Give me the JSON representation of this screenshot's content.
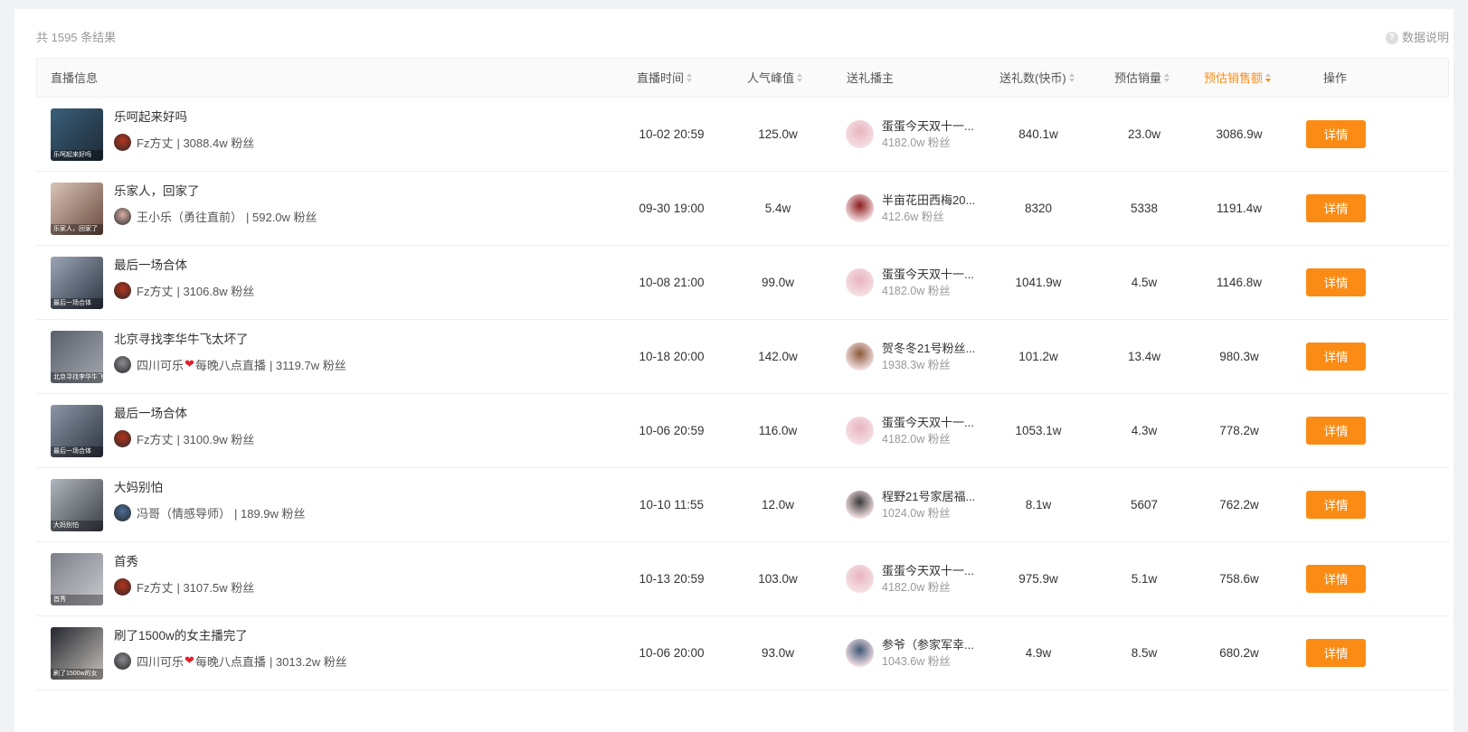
{
  "summary": "共 1595 条结果",
  "help": "数据说明",
  "columns": {
    "info": "直播信息",
    "time": "直播时间",
    "peak": "人气峰值",
    "gifter": "送礼播主",
    "gifts": "送礼数(快币)",
    "sales_qty": "预估销量",
    "sales_amt": "预估销售额",
    "action": "操作"
  },
  "detail_label": "详情",
  "colors": {
    "accent": "#fa8c16",
    "heart": "#e0202a"
  },
  "rows": [
    {
      "title": "乐呵起来好吗",
      "thumb_caption": "乐呵起来好吗",
      "host": "Fz方丈",
      "host_heart": false,
      "host_suffix": "",
      "host_fans": "| 3088.4w 粉丝",
      "time": "10-02 20:59",
      "peak": "125.0w",
      "gifter": "蛋蛋今天双十一...",
      "gifter_fans": "4182.0w 粉丝",
      "gifts": "840.1w",
      "sales_qty": "23.0w",
      "sales_amt": "3086.9w"
    },
    {
      "title": "乐家人，回家了",
      "thumb_caption": "乐家人，回家了",
      "host": "王小乐（勇往直前）",
      "host_heart": false,
      "host_suffix": "",
      "host_fans": "| 592.0w 粉丝",
      "time": "09-30 19:00",
      "peak": "5.4w",
      "gifter": "半亩花田西梅20...",
      "gifter_fans": "412.6w 粉丝",
      "gifts": "8320",
      "sales_qty": "5338",
      "sales_amt": "1191.4w"
    },
    {
      "title": "最后一场合体",
      "thumb_caption": "最后一场合体",
      "host": "Fz方丈",
      "host_heart": false,
      "host_suffix": "",
      "host_fans": "| 3106.8w 粉丝",
      "time": "10-08 21:00",
      "peak": "99.0w",
      "gifter": "蛋蛋今天双十一...",
      "gifter_fans": "4182.0w 粉丝",
      "gifts": "1041.9w",
      "sales_qty": "4.5w",
      "sales_amt": "1146.8w"
    },
    {
      "title": "北京寻找李华牛飞太坏了",
      "thumb_caption": "北京寻找李华牛飞太",
      "host": "四川可乐",
      "host_heart": true,
      "host_suffix": "每晚八点直播",
      "host_fans": "| 3119.7w 粉丝",
      "time": "10-18 20:00",
      "peak": "142.0w",
      "gifter": "贺冬冬21号粉丝...",
      "gifter_fans": "1938.3w 粉丝",
      "gifts": "101.2w",
      "sales_qty": "13.4w",
      "sales_amt": "980.3w"
    },
    {
      "title": "最后一场合体",
      "thumb_caption": "最后一场合体",
      "host": "Fz方丈",
      "host_heart": false,
      "host_suffix": "",
      "host_fans": "| 3100.9w 粉丝",
      "time": "10-06 20:59",
      "peak": "116.0w",
      "gifter": "蛋蛋今天双十一...",
      "gifter_fans": "4182.0w 粉丝",
      "gifts": "1053.1w",
      "sales_qty": "4.3w",
      "sales_amt": "778.2w"
    },
    {
      "title": "大妈别怕",
      "thumb_caption": "大妈别怕",
      "host": "冯哥（情感导师）",
      "host_heart": false,
      "host_suffix": "",
      "host_fans": "| 189.9w 粉丝",
      "time": "10-10 11:55",
      "peak": "12.0w",
      "gifter": "程野21号家居福...",
      "gifter_fans": "1024.0w 粉丝",
      "gifts": "8.1w",
      "sales_qty": "5607",
      "sales_amt": "762.2w"
    },
    {
      "title": "首秀",
      "thumb_caption": "首秀",
      "host": "Fz方丈",
      "host_heart": false,
      "host_suffix": "",
      "host_fans": "| 3107.5w 粉丝",
      "time": "10-13 20:59",
      "peak": "103.0w",
      "gifter": "蛋蛋今天双十一...",
      "gifter_fans": "4182.0w 粉丝",
      "gifts": "975.9w",
      "sales_qty": "5.1w",
      "sales_amt": "758.6w"
    },
    {
      "title": "刷了1500w的女主播完了",
      "thumb_caption": "刷了1500w的女",
      "host": "四川可乐",
      "host_heart": true,
      "host_suffix": "每晚八点直播",
      "host_fans": "| 3013.2w 粉丝",
      "time": "10-06 20:00",
      "peak": "93.0w",
      "gifter": "参爷（参家军幸...",
      "gifter_fans": "1043.6w 粉丝",
      "gifts": "4.9w",
      "sales_qty": "8.5w",
      "sales_amt": "680.2w"
    }
  ]
}
